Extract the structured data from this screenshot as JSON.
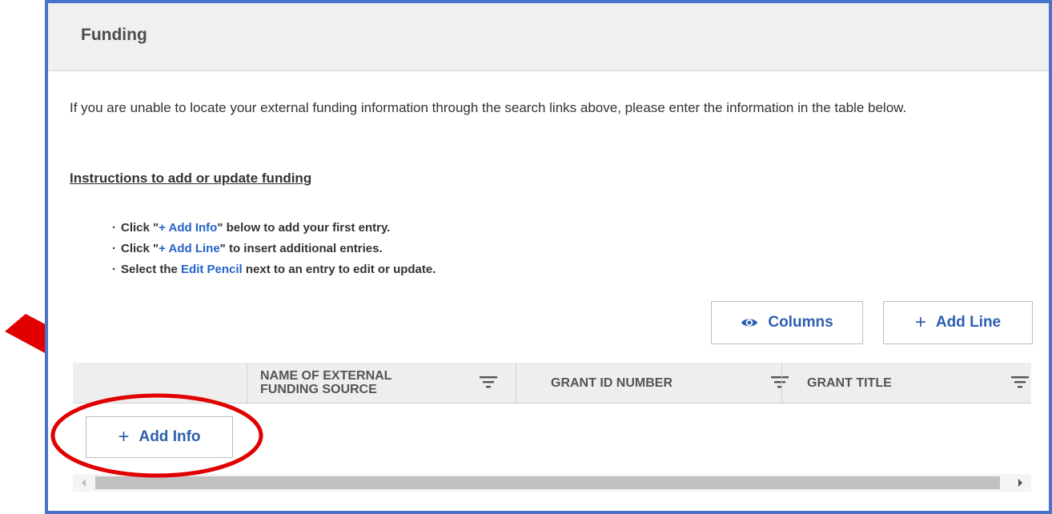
{
  "panel": {
    "title": "Funding"
  },
  "intro": {
    "text": "If you are unable to locate your external funding information through the search links above, please enter the information in the table below."
  },
  "instructions": {
    "heading": "Instructions to add or update funding",
    "items": [
      {
        "pre": "Click \"",
        "highlight": "+ Add Info",
        "post": "\" below to add your first entry."
      },
      {
        "pre": "Click \"",
        "highlight": "+ Add Line",
        "post": "\" to insert additional entries."
      },
      {
        "pre": "Select the ",
        "highlight": "Edit Pencil",
        "post": " next to an entry to edit or update."
      }
    ]
  },
  "toolbar": {
    "columns_label": "Columns",
    "add_line_label": "Add Line"
  },
  "table": {
    "columns": [
      {
        "label": "NAME OF EXTERNAL FUNDING SOURCE"
      },
      {
        "label": "GRANT ID NUMBER"
      },
      {
        "label": "GRANT TITLE"
      }
    ],
    "add_info_label": "Add Info"
  },
  "icons": {
    "columns": "eye-icon",
    "add": "plus-icon",
    "filter": "filter-icon",
    "annotation_arrow": "red-arrow",
    "annotation_ellipse": "red-ellipse"
  },
  "colors": {
    "frame_border": "#4a72c8",
    "accent": "#2d5fae",
    "highlight_text": "#2563c7",
    "annotation": "#e00000",
    "header_bg": "#f0f0f0"
  }
}
